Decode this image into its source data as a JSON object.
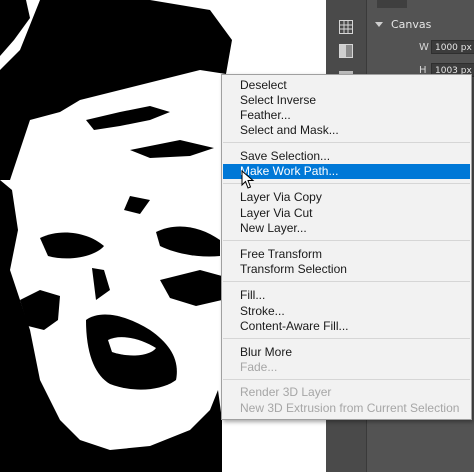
{
  "panel": {
    "section_title": "Canvas",
    "width_label": "W",
    "width_value": "1000 px",
    "height_label": "H",
    "height_value": "1003 px"
  },
  "context_menu": {
    "items": [
      {
        "label": "Deselect",
        "state": "normal"
      },
      {
        "label": "Select Inverse",
        "state": "normal"
      },
      {
        "label": "Feather...",
        "state": "normal"
      },
      {
        "label": "Select and Mask...",
        "state": "normal"
      },
      {
        "label": "Save Selection...",
        "state": "normal"
      },
      {
        "label": "Make Work Path...",
        "state": "highlighted"
      },
      {
        "label": "Layer Via Copy",
        "state": "normal"
      },
      {
        "label": "Layer Via Cut",
        "state": "normal"
      },
      {
        "label": "New Layer...",
        "state": "normal"
      },
      {
        "label": "Free Transform",
        "state": "normal"
      },
      {
        "label": "Transform Selection",
        "state": "normal"
      },
      {
        "label": "Fill...",
        "state": "normal"
      },
      {
        "label": "Stroke...",
        "state": "normal"
      },
      {
        "label": "Content-Aware Fill...",
        "state": "normal"
      },
      {
        "label": "Blur More",
        "state": "normal"
      },
      {
        "label": "Fade...",
        "state": "disabled"
      },
      {
        "label": "Render 3D Layer",
        "state": "disabled"
      },
      {
        "label": "New 3D Extrusion from Current Selection",
        "state": "disabled"
      }
    ]
  },
  "colors": {
    "highlight": "#0078d7",
    "menu_background": "#f2f2f2",
    "panel_background": "#535353"
  },
  "icons": {
    "tools": [
      "grid-icon",
      "gradient-swatch-icon",
      "layers-icon"
    ],
    "cursor": "arrow-cursor-icon"
  }
}
